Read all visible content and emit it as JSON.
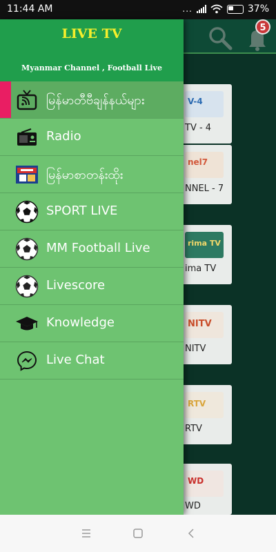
{
  "status_bar": {
    "time": "11:44 AM",
    "indicators": "...",
    "battery": "37%"
  },
  "drawer": {
    "title": "LIVE TV",
    "subtitle": "Myanmar Channel , Football Live",
    "accent_color": "#e91e63",
    "items": [
      {
        "label": "မြန်မာတီဗီချန်နယ်များ",
        "icon": "tv-icon",
        "active": true
      },
      {
        "label": "Radio",
        "icon": "radio-icon"
      },
      {
        "label": "မြန်မာစာတန်းထိုး",
        "icon": "movie-poster-icon"
      },
      {
        "label": "SPORT LIVE",
        "icon": "soccer-ball-icon"
      },
      {
        "label": "MM Football Live",
        "icon": "soccer-ball-icon"
      },
      {
        "label": "Livescore",
        "icon": "soccer-ball-icon"
      },
      {
        "label": "Knowledge",
        "icon": "graduation-cap-icon"
      },
      {
        "label": "Live Chat",
        "icon": "messenger-icon"
      }
    ]
  },
  "background": {
    "notification_count": "5",
    "channels": [
      {
        "name": "TV - 4",
        "logo": "V-4"
      },
      {
        "name": "NNEL - 7",
        "logo": "nel7"
      },
      {
        "name": "ima TV",
        "logo": "rima TV"
      },
      {
        "name": "NITV",
        "logo": "NITV"
      },
      {
        "name": "RTV",
        "logo": "RTV"
      },
      {
        "name": "WD",
        "logo": "WD"
      }
    ]
  },
  "nav_bar": {
    "buttons": [
      "recents-icon",
      "home-icon",
      "back-icon"
    ]
  }
}
